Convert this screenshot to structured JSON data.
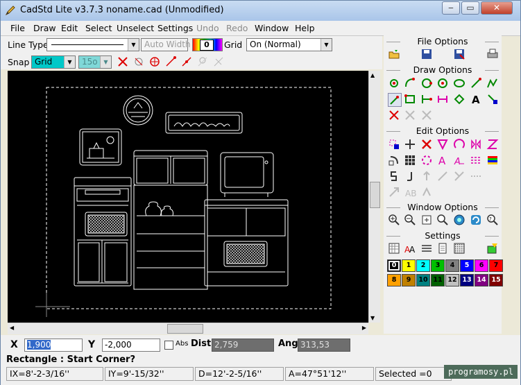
{
  "window": {
    "title": "CadStd Lite v3.7.3  noname.cad  (Unmodified)",
    "minimize": "‒",
    "maximize": "▭",
    "close": "✕"
  },
  "menu": [
    "File",
    "Draw",
    "Edit",
    "Select",
    "Unselect",
    "Settings",
    "Undo",
    "Redo",
    "Window",
    "Help"
  ],
  "toolbar": {
    "line_type_label": "Line Type",
    "auto_width": "Auto Width",
    "color_value": "0",
    "grid_label": "Grid",
    "grid_mode": "On (Normal)",
    "snap_label": "Snap",
    "snap_mode": "Grid",
    "snap_angle": "15o"
  },
  "panel": {
    "file_options": "File Options",
    "draw_options": "Draw Options",
    "edit_options": "Edit Options",
    "window_options": "Window Options",
    "settings": "Settings",
    "palette": [
      {
        "label": "0",
        "color": "#000000",
        "text": "#ffffff"
      },
      {
        "label": "1",
        "color": "#ffff00",
        "text": "#000000"
      },
      {
        "label": "2",
        "color": "#00ffff",
        "text": "#000000"
      },
      {
        "label": "3",
        "color": "#00c000",
        "text": "#000000"
      },
      {
        "label": "4",
        "color": "#808080",
        "text": "#000000"
      },
      {
        "label": "5",
        "color": "#0000ff",
        "text": "#ffffff"
      },
      {
        "label": "6",
        "color": "#ff00ff",
        "text": "#000000"
      },
      {
        "label": "7",
        "color": "#ff0000",
        "text": "#000000"
      },
      {
        "label": "8",
        "color": "#ffa000",
        "text": "#000000"
      },
      {
        "label": "9",
        "color": "#c08000",
        "text": "#000000"
      },
      {
        "label": "10",
        "color": "#008080",
        "text": "#000000"
      },
      {
        "label": "11",
        "color": "#006000",
        "text": "#000000"
      },
      {
        "label": "12",
        "color": "#c0c0c0",
        "text": "#000000"
      },
      {
        "label": "13",
        "color": "#000080",
        "text": "#ffffff"
      },
      {
        "label": "14",
        "color": "#800080",
        "text": "#ffffff"
      },
      {
        "label": "15",
        "color": "#800000",
        "text": "#ffffff"
      }
    ]
  },
  "coords": {
    "x_label": "X",
    "x_value": "1,900",
    "y_label": "Y",
    "y_value": "-2,000",
    "abs_label": "Abs",
    "dist_label": "Dist",
    "dist_value": "2,759",
    "ang_label": "Ang",
    "ang_value": "313,53"
  },
  "prompt": "Rectangle : Start Corner?",
  "status": {
    "x": "IX=8'-2-3/16''",
    "y": "IY=9'-15/32''",
    "d": "D=12'-2-5/16''",
    "a": "A=47°51'12''",
    "selected": "Selected =0"
  },
  "watermark": "programosy.pl"
}
